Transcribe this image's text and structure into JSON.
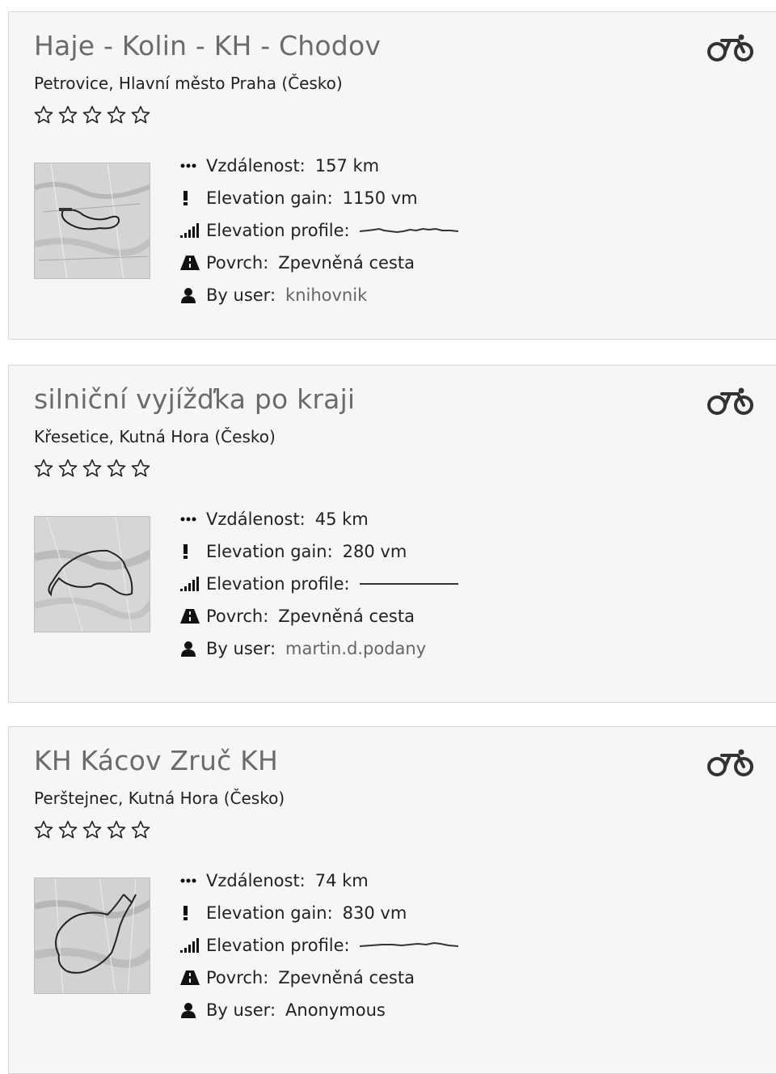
{
  "labels": {
    "distance": "Vzdálenost:",
    "elevation_gain": "Elevation gain:",
    "elevation_profile": "Elevation profile:",
    "surface": "Povrch:",
    "by_user": "By user:"
  },
  "icons": {
    "activity": "bicycle-icon",
    "rating": "star-outline-icon",
    "distance": "dots-icon",
    "elevation_gain": "exclamation-icon",
    "elevation_profile": "signal-bars-icon",
    "surface": "road-icon",
    "user": "user-icon"
  },
  "colors": {
    "card_background": "#f6f6f6",
    "card_border": "#d7d7d7",
    "title": "#6b6b6b",
    "user_link": "#666666"
  },
  "routes": [
    {
      "title": "Haje - Kolin - KH - Chodov",
      "location": "Petrovice, Hlavní město Praha (Česko)",
      "rating": 0,
      "rating_max": 5,
      "distance": "157 km",
      "elevation_gain": "1150 vm",
      "surface": "Zpevněná cesta",
      "user": "knihovnik"
    },
    {
      "title": "silniční vyjížďka po kraji",
      "location": "Křesetice, Kutná Hora (Česko)",
      "rating": 0,
      "rating_max": 5,
      "distance": "45 km",
      "elevation_gain": "280 vm",
      "surface": "Zpevněná cesta",
      "user": "martin.d.podany"
    },
    {
      "title": "KH Kácov Zruč KH",
      "location": "Perštejnec, Kutná Hora (Česko)",
      "rating": 0,
      "rating_max": 5,
      "distance": "74 km",
      "elevation_gain": "830 vm",
      "surface": "Zpevněná cesta",
      "user": "Anonymous"
    }
  ]
}
